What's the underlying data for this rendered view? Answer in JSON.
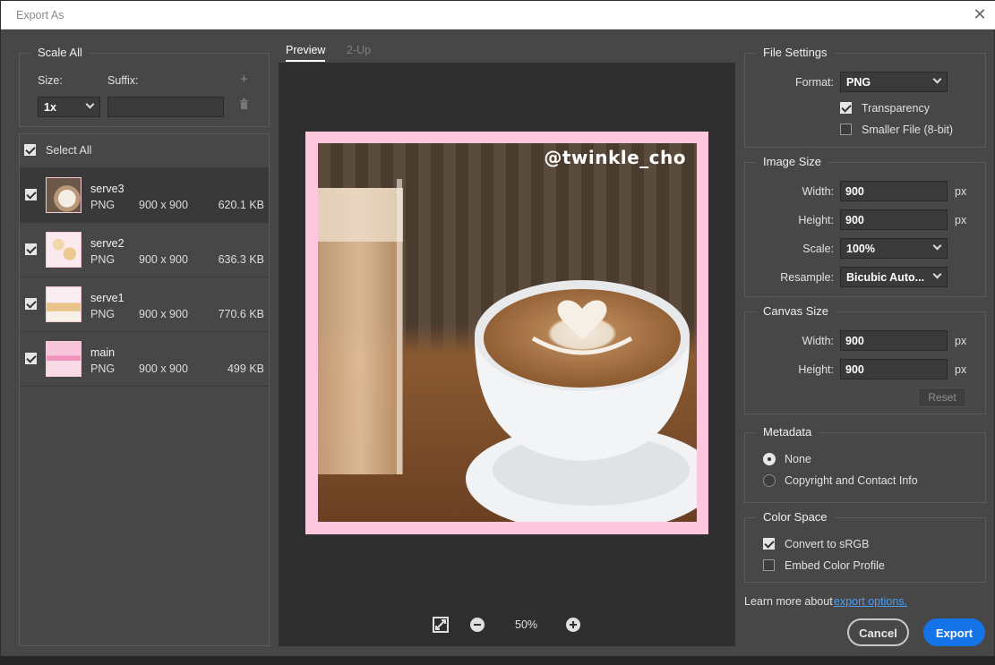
{
  "window": {
    "title": "Export As"
  },
  "left": {
    "scale_all": {
      "title": "Scale All",
      "size_label": "Size:",
      "suffix_label": "Suffix:",
      "size_value": "1x",
      "suffix_value": ""
    },
    "select_all_label": "Select All",
    "assets": [
      {
        "name": "serve3",
        "format": "PNG",
        "dimensions": "900 x 900",
        "size": "620.1 KB",
        "checked": true,
        "selected": true
      },
      {
        "name": "serve2",
        "format": "PNG",
        "dimensions": "900 x 900",
        "size": "636.3 KB",
        "checked": true,
        "selected": false
      },
      {
        "name": "serve1",
        "format": "PNG",
        "dimensions": "900 x 900",
        "size": "770.6 KB",
        "checked": true,
        "selected": false
      },
      {
        "name": "main",
        "format": "PNG",
        "dimensions": "900 x 900",
        "size": "499 KB",
        "checked": true,
        "selected": false
      }
    ]
  },
  "center": {
    "tabs": [
      {
        "label": "Preview",
        "active": true
      },
      {
        "label": "2-Up",
        "active": false
      }
    ],
    "preview_watermark": "@twinkle_cho",
    "zoom_level": "50%"
  },
  "right": {
    "file_settings": {
      "title": "File Settings",
      "format_label": "Format:",
      "format_value": "PNG",
      "transparency_label": "Transparency",
      "transparency_checked": true,
      "smaller_file_label": "Smaller File (8-bit)",
      "smaller_file_checked": false
    },
    "image_size": {
      "title": "Image Size",
      "width_label": "Width:",
      "width_value": "900",
      "height_label": "Height:",
      "height_value": "900",
      "unit": "px",
      "scale_label": "Scale:",
      "scale_value": "100%",
      "resample_label": "Resample:",
      "resample_value": "Bicubic Auto..."
    },
    "canvas_size": {
      "title": "Canvas Size",
      "width_label": "Width:",
      "width_value": "900",
      "height_label": "Height:",
      "height_value": "900",
      "unit": "px",
      "reset_label": "Reset"
    },
    "metadata": {
      "title": "Metadata",
      "options": [
        {
          "label": "None",
          "selected": true
        },
        {
          "label": "Copyright and Contact Info",
          "selected": false
        }
      ]
    },
    "color_space": {
      "title": "Color Space",
      "convert_label": "Convert to sRGB",
      "convert_checked": true,
      "embed_label": "Embed Color Profile",
      "embed_checked": false
    },
    "learn_more_text": "Learn more about",
    "learn_more_link": "export options.",
    "cancel_label": "Cancel",
    "export_label": "Export"
  },
  "colors": {
    "accent": "#1473e6",
    "frame_pink": "#ffc7dd",
    "panel_bg": "#474747",
    "preview_bg": "#2f2f2f"
  }
}
